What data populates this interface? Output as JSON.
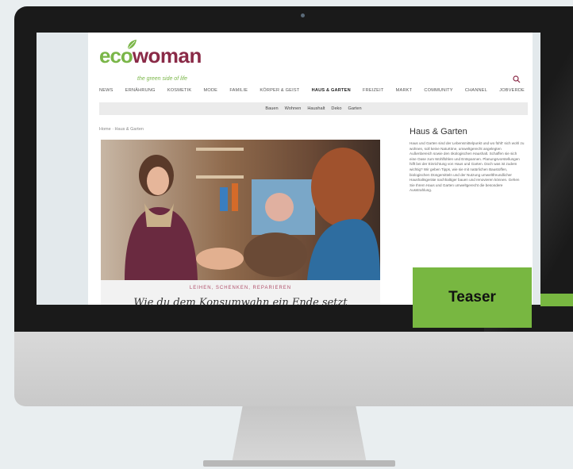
{
  "site": {
    "logo": {
      "eco": "eco",
      "woman": "woman",
      "tagline": "the green side of life"
    },
    "mainnav": [
      "NEWS",
      "ERNÄHRUNG",
      "KOSMETIK",
      "MODE",
      "FAMILIE",
      "KÖRPER & GEIST",
      "HAUS & GARTEN",
      "FREIZEIT",
      "MARKT",
      "COMMUNITY",
      "CHANNEL",
      "JOBVERDE"
    ],
    "mainnav_active": "HAUS & GARTEN",
    "subnav": [
      "Bauen",
      "Wohnen",
      "Haushalt",
      "Deko",
      "Garten"
    ],
    "breadcrumb": "Home · Haus & Garten",
    "article": {
      "kicker": "LEIHEN, SCHENKEN, REPARIEREN",
      "title": "Wie du dem Konsumwahn ein Ende setzt"
    },
    "sidebar": {
      "title": "Haus & Garten",
      "text": "Haus und Garten sind der Lebensmittelpunkt und wo fühlt' sich wohl zu wohnen, soll keine Naturtöne, umweltgerecht angelegten Außenbereich sowie den ökologischen Haushalt. Schaffen sie sich eine Oase zum Wohlfühlen und Entspannen. Planungsvorstellungen hilft bei der Einrichtung von Haus und Garten. Doch was ist zudem wichtig? Wir geben Tipps, wie sie mit natürlichen Baustoffen, biologischen Düngemitteln und der Nutzung umweltfreundlicher Haushaltsgeräte nachhaltiger bauen und renovieren können. Gehen Sie Ihrem Haus und Garten umweltgerecht die besondere Ausstrahlung."
    }
  },
  "overlay": {
    "teaser_label": "Teaser"
  },
  "colors": {
    "brand_green": "#7ab648",
    "brand_wine": "#8a2a47",
    "teaser_green": "#78b741",
    "bezel": "#1a1a1a"
  }
}
